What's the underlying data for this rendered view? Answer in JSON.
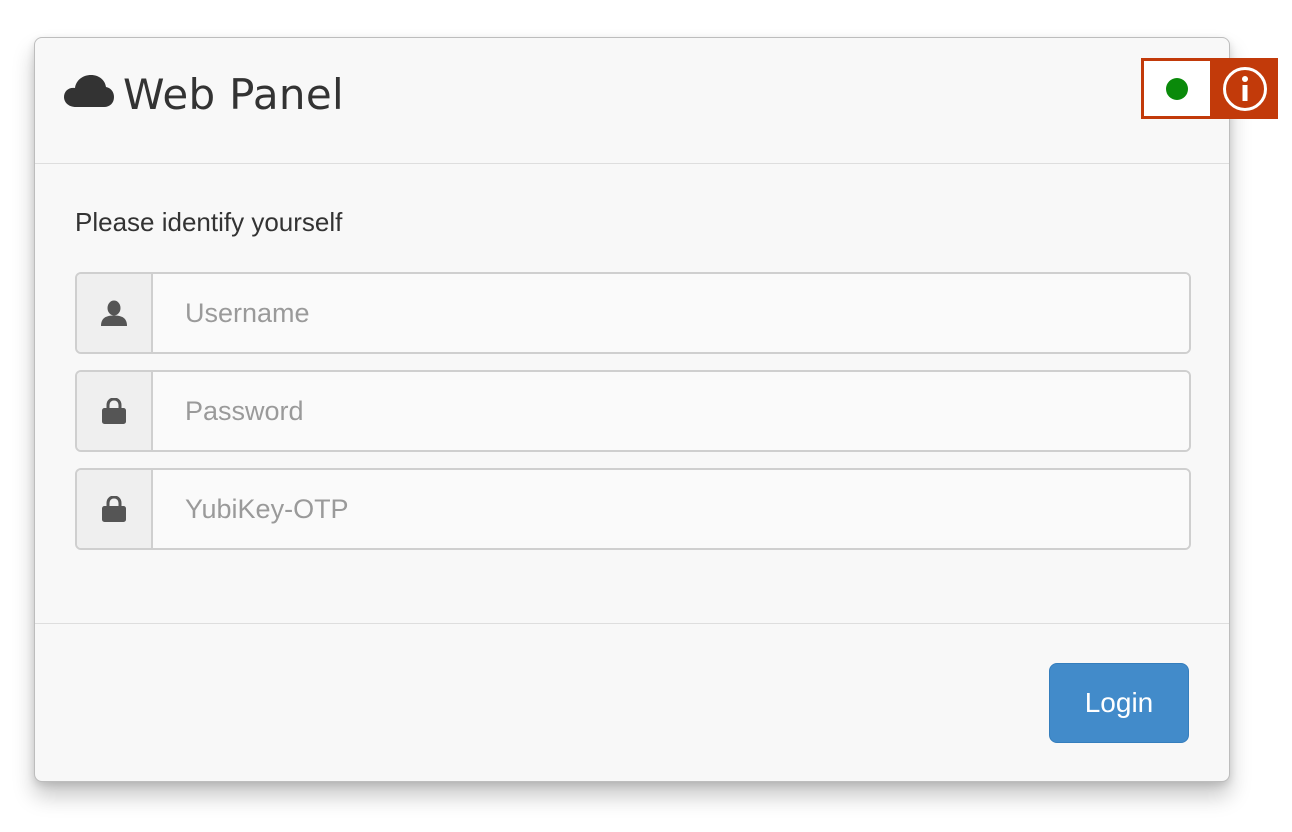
{
  "header": {
    "title": "Web Panel",
    "logo_icon": "cloud-icon"
  },
  "status": {
    "indicator_color": "#0a8a0a",
    "state": "online",
    "info_icon": "info-icon",
    "accent_color": "#c23a0a"
  },
  "form": {
    "prompt": "Please identify yourself",
    "fields": [
      {
        "icon": "user-icon",
        "placeholder": "Username",
        "value": ""
      },
      {
        "icon": "lock-icon",
        "placeholder": "Password",
        "value": ""
      },
      {
        "icon": "lock-icon",
        "placeholder": "YubiKey-OTP",
        "value": ""
      }
    ]
  },
  "footer": {
    "login_label": "Login",
    "button_color": "#428bca"
  }
}
